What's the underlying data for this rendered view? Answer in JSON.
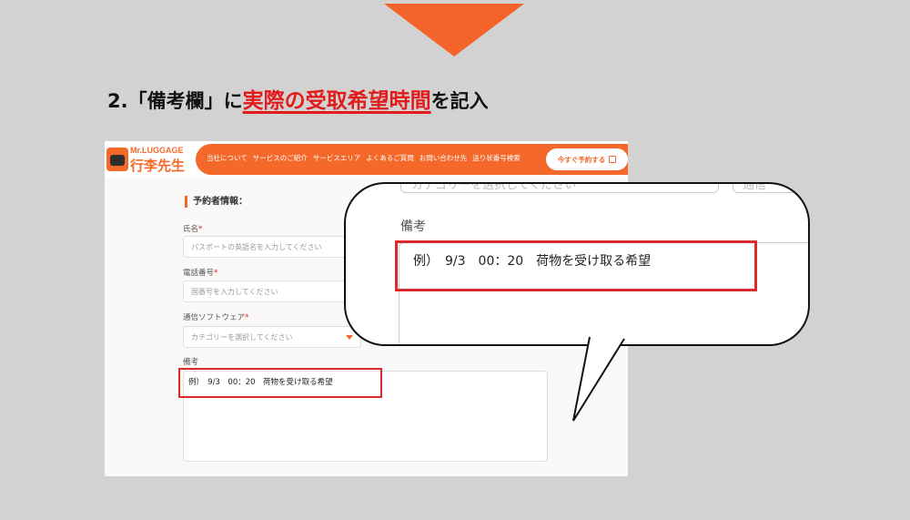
{
  "heading": {
    "prefix": "2.「備考欄」に",
    "highlight": "実際の受取希望時間",
    "suffix": "を記入"
  },
  "colors": {
    "accent": "#f4632a",
    "highlight": "#e21b1b"
  },
  "site": {
    "logo_en": "Mr.LUGGAGE",
    "logo_jp": "行李先生",
    "nav": [
      "当社について",
      "サービスのご紹介",
      "サービスエリア",
      "よくあるご質問",
      "お問い合わせ先",
      "送り状番号検索"
    ],
    "reserve_button": "今すぐ予約する",
    "form": {
      "title": "予約者情報：",
      "name_label": "氏名",
      "name_placeholder": "パスポートの英語名を入力してください",
      "phone_label": "電話番号",
      "phone_placeholder": "国番号を入力してください",
      "app_label": "通信ソフトウェア",
      "app_placeholder": "カテゴリーを選択してください",
      "notes_label": "備考",
      "notes_value": "例）　9/3　00：20　荷物を受け取る希望",
      "required_mark": "*"
    }
  },
  "bubble": {
    "faint_left": "カテゴリーを選択してください",
    "faint_right": "通信",
    "label": "備考",
    "text": "例）　9/3　00：20　荷物を受け取る希望"
  }
}
